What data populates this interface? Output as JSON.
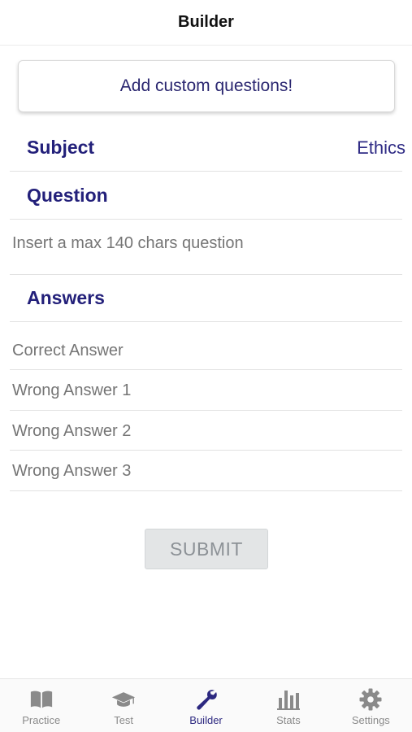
{
  "navbar": {
    "title": "Builder"
  },
  "banner": {
    "text": "Add custom questions!"
  },
  "subject": {
    "label": "Subject",
    "value": "Ethics"
  },
  "question": {
    "label": "Question",
    "placeholder": "Insert a max 140 chars question"
  },
  "answers": {
    "label": "Answers",
    "fields": [
      {
        "placeholder": "Correct Answer"
      },
      {
        "placeholder": "Wrong Answer 1"
      },
      {
        "placeholder": "Wrong Answer 2"
      },
      {
        "placeholder": "Wrong Answer 3"
      }
    ]
  },
  "submit": {
    "label": "SUBMIT"
  },
  "tabs": [
    {
      "label": "Practice",
      "icon": "book-icon",
      "active": false
    },
    {
      "label": "Test",
      "icon": "graduation-cap-icon",
      "active": false
    },
    {
      "label": "Builder",
      "icon": "wrench-icon",
      "active": true
    },
    {
      "label": "Stats",
      "icon": "bar-chart-icon",
      "active": false
    },
    {
      "label": "Settings",
      "icon": "gear-icon",
      "active": false
    }
  ],
  "colors": {
    "accent": "#2c2880",
    "inactive": "#8a8a8a",
    "placeholder": "#7a7f87"
  }
}
